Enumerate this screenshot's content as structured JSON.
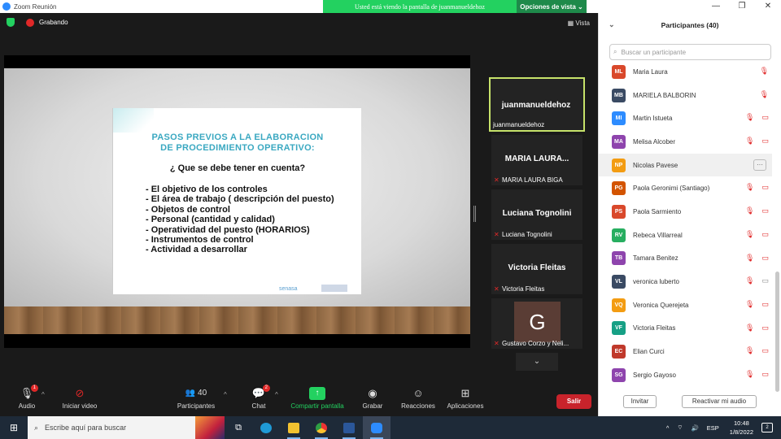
{
  "window": {
    "title": "Zoom Reunión",
    "controls": [
      "—",
      "❐",
      "✕"
    ]
  },
  "share_banner": {
    "message": "Usted está viendo la pantalla de juanmanueldehoz",
    "options": "Opciones de vista ⌄"
  },
  "meeting": {
    "recording": "Grabando",
    "view": "Vista"
  },
  "slide": {
    "title_line1": "PASOS PREVIOS A LA ELABORACION",
    "title_line2": "DE PROCEDIMIENTO OPERATIVO:",
    "question": "¿ Que se debe tener en cuenta?",
    "bullets": [
      "-  El objetivo de los controles",
      "-  El área de trabajo ( descripción del   puesto)",
      "-  Objetos de control",
      "-  Personal (cantidad y calidad)",
      "-  Operatividad del puesto (HORARIOS)",
      "-  Instrumentos  de control",
      "-  Actividad  a desarrollar"
    ],
    "logo": "senasa"
  },
  "tiles": [
    {
      "name": "juanmanueldehoz",
      "label": "juanmanueldehoz"
    },
    {
      "name": "MARIA LAURA...",
      "label": "MARIA LAURA BIGA"
    },
    {
      "name": "Luciana Tognolini",
      "label": "Luciana Tognolini"
    },
    {
      "name": "Victoria Fleitas",
      "label": "Victoria Fleitas"
    },
    {
      "avatar_letter": "G",
      "label": "Gustavo Corzo y Neli..."
    }
  ],
  "toolbar": {
    "audio": "Audio",
    "audio_badge": "1",
    "video": "Iniciar video",
    "participants": "Participantes",
    "participants_count": "40",
    "chat": "Chat",
    "chat_badge": "2",
    "share": "Compartir pantalla",
    "record": "Grabar",
    "reactions": "Reacciones",
    "apps": "Aplicaciones",
    "leave": "Salir"
  },
  "panel": {
    "title": "Participantes (40)",
    "search_placeholder": "Buscar un participante",
    "participants": [
      {
        "initials": "ML",
        "name": "Maria Laura",
        "color": "#d9482b"
      },
      {
        "initials": "MB",
        "name": "MARIELA BALBORIN",
        "color": "#3a4a63"
      },
      {
        "initials": "MI",
        "name": "Martin Istueta",
        "color": "#2d8cff"
      },
      {
        "initials": "MA",
        "name": "Melisa Alcober",
        "color": "#8e44ad"
      },
      {
        "initials": "NP",
        "name": "Nicolas Pavese",
        "color": "#f39c12"
      },
      {
        "initials": "PG",
        "name": "Paola Geronimi (Santiago)",
        "color": "#d35400"
      },
      {
        "initials": "PS",
        "name": "Paola Sarmiento",
        "color": "#d9482b"
      },
      {
        "initials": "RV",
        "name": "Rebeca Villarreal",
        "color": "#27ae60"
      },
      {
        "initials": "TB",
        "name": "Tamara Benitez",
        "color": "#8e44ad"
      },
      {
        "initials": "VL",
        "name": "veronica luberto",
        "color": "#3a4a63"
      },
      {
        "initials": "VQ",
        "name": "Veronica Querejeta",
        "color": "#f39c12"
      },
      {
        "initials": "VF",
        "name": "Victoria Fleitas",
        "color": "#16a085"
      },
      {
        "initials": "EC",
        "name": "Elian Curci",
        "color": "#c0392b"
      },
      {
        "initials": "SG",
        "name": "Sergio Gayoso",
        "color": "#8e44ad"
      }
    ],
    "more_button": "···",
    "invite": "Invitar",
    "reclaim_audio": "Reactivar mi audio"
  },
  "taskbar": {
    "search_placeholder": "Escribe aquí para buscar",
    "language": "ESP",
    "time": "10:48",
    "date": "1/8/2022",
    "notifications": "2"
  }
}
